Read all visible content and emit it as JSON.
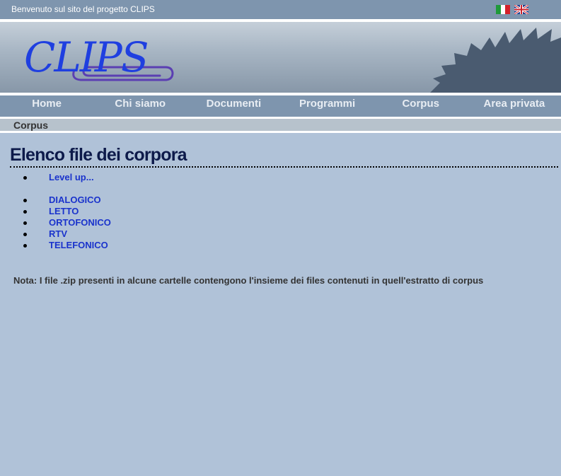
{
  "header": {
    "welcome_text": "Benvenuto sul sito del progetto CLIPS",
    "languages": [
      {
        "name": "Italiano",
        "icon": "italian-flag-icon"
      },
      {
        "name": "English",
        "icon": "uk-flag-icon"
      }
    ]
  },
  "banner": {
    "logo_text": "CLIPS"
  },
  "nav": {
    "items": [
      {
        "label": "Home"
      },
      {
        "label": "Chi siamo"
      },
      {
        "label": "Documenti"
      },
      {
        "label": "Programmi"
      },
      {
        "label": "Corpus"
      },
      {
        "label": "Area privata"
      }
    ]
  },
  "breadcrumb": {
    "current": "Corpus"
  },
  "main": {
    "title": "Elenco file dei corpora",
    "level_up": "Level up...",
    "folders": [
      {
        "label": "DIALOGICO"
      },
      {
        "label": "LETTO"
      },
      {
        "label": "ORTOFONICO"
      },
      {
        "label": "RTV"
      },
      {
        "label": "TELEFONICO"
      }
    ],
    "note": "Nota: I file .zip presenti in alcune cartelle contengono l'insieme dei files contenuti in quell'estratto di corpus"
  },
  "colors": {
    "background": "#b0c2d8",
    "bar": "#7e95ae",
    "link": "#1a33cc",
    "title": "#0d1a4a"
  }
}
